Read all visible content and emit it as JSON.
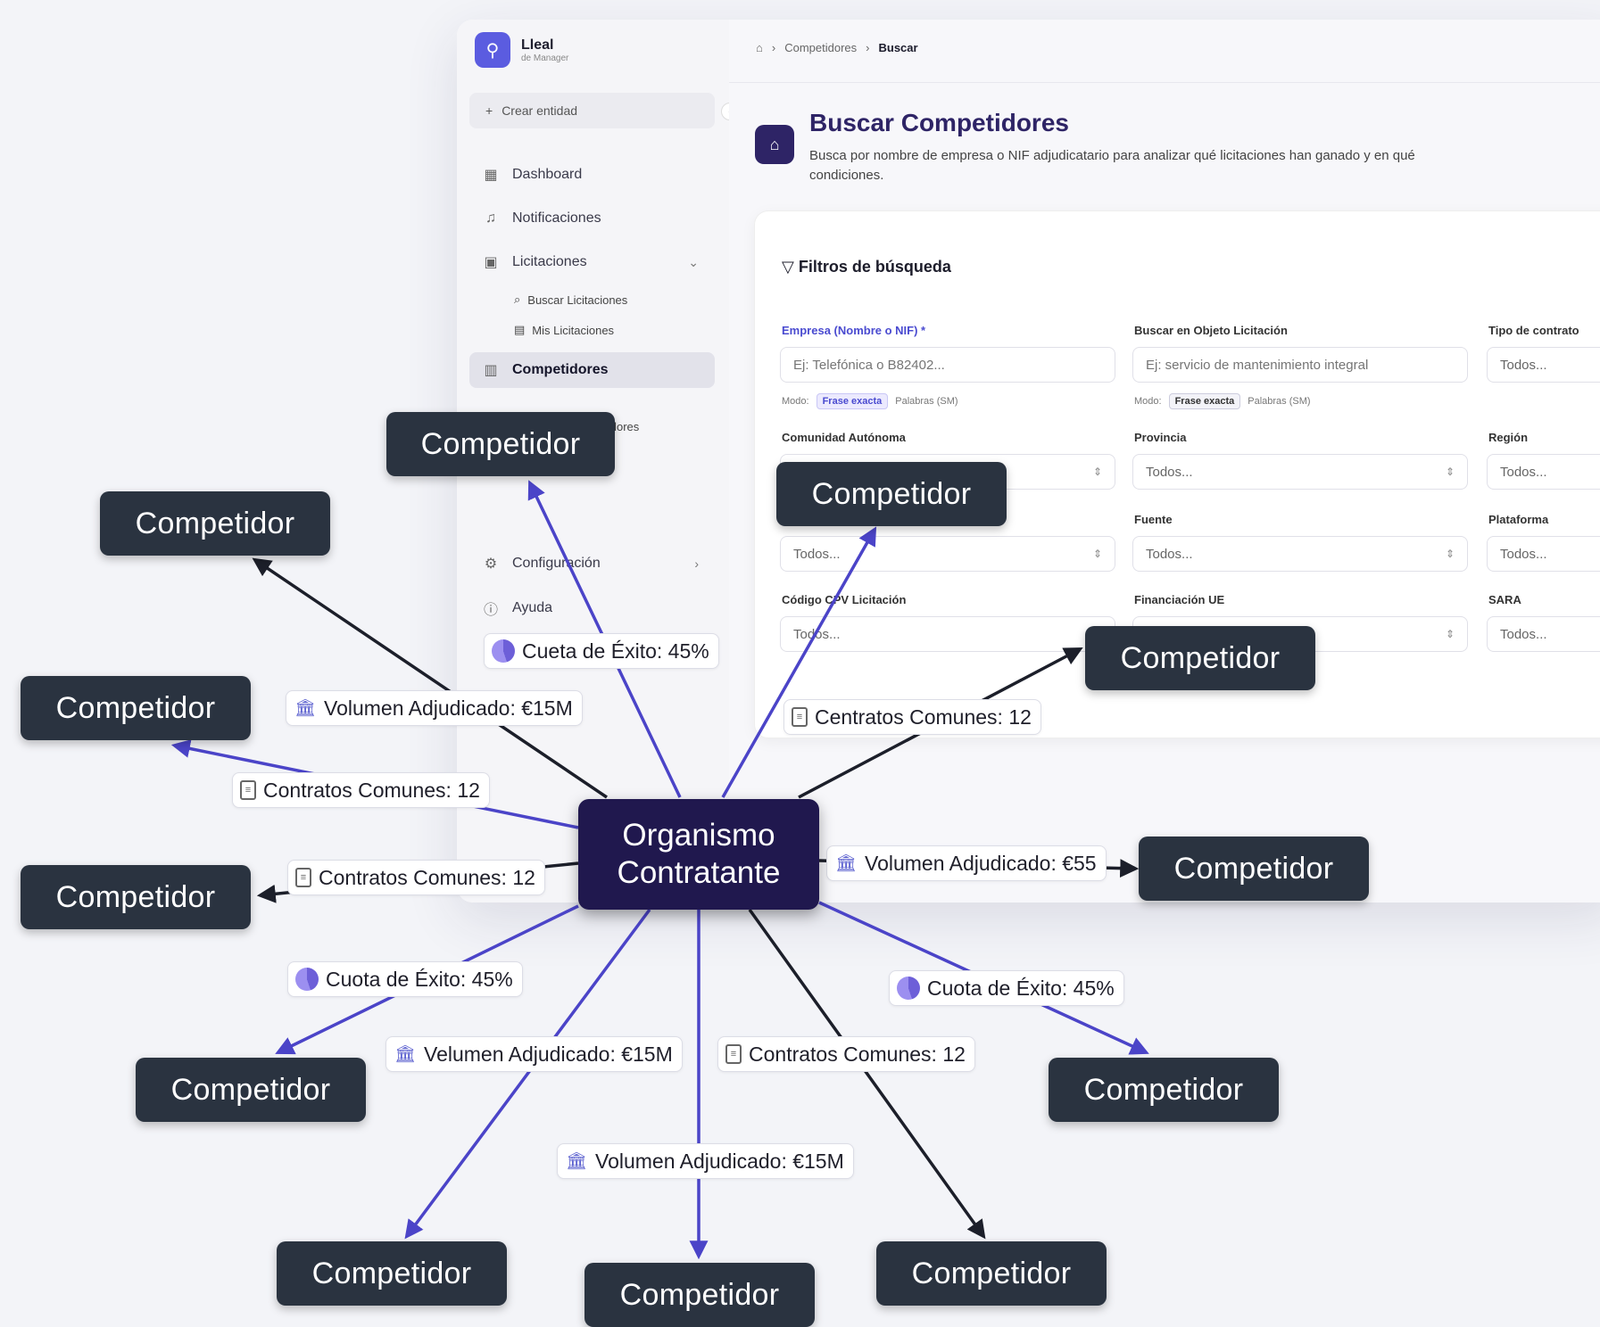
{
  "app": {
    "brand_name": "Lleal",
    "brand_sub": "de Manager",
    "create_entity": "Crear entidad",
    "nav": {
      "dashboard": "Dashboard",
      "notifications": "Notificaciones",
      "licitaciones": "Licitaciones",
      "buscar_licitaciones": "Buscar Licitaciones",
      "mis_licitaciones": "Mis Licitaciones",
      "competidores": "Competidores",
      "buscar_competidores": "Buscar Competidores",
      "configuracion": "Configuración",
      "ayuda": "Ayuda"
    },
    "breadcrumb": {
      "level1": "Competidores",
      "level2": "Buscar"
    },
    "page_title": "Buscar Competidores",
    "page_desc": "Busca por nombre de empresa o NIF adjudicatario para analizar qué licitaciones han ganado y en qué condiciones.",
    "filters": {
      "title": "Filtros de búsqueda",
      "empresa_label": "Empresa (Nombre o NIF) *",
      "empresa_placeholder": "Ej: Telefónica o B82402...",
      "objeto_label": "Buscar en Objeto Licitación",
      "objeto_placeholder": "Ej: servicio de mantenimiento integral",
      "tipo_label": "Tipo de contrato",
      "modo_label": "Modo:",
      "modo_exacta": "Frase exacta",
      "modo_palabras": "Palabras (SM)",
      "comunidad_label": "Comunidad Autónoma",
      "provincia_label": "Provincia",
      "region_label": "Región",
      "fuente_label": "Fuente",
      "plataforma_label": "Plataforma",
      "cpv_label": "Código CPV Licitación",
      "financiacion_label": "Financiación UE",
      "sara_label": "SARA",
      "todos": "Todos..."
    }
  },
  "diagram": {
    "center": {
      "line1": "Organismo",
      "line2": "Contratante"
    },
    "competitor_label": "Competidor",
    "edge_labels": [
      "Cueta de Éxito: 45%",
      "Volumen Adjudicado: €15M",
      "Contratos Comunes: 12",
      "Contratos Comunes: 12",
      "Cuota de Éxito: 45%",
      "Velumen Adjudicado: €15M",
      "Volumen Adjudicado: €15M",
      "Contratos Comunes: 12",
      "Cuota de Éxito: 45%",
      "Volumen Adjudicado: €55",
      "Centratos Comunes: 12"
    ],
    "colors": {
      "edge_purple": "#4b44c8",
      "edge_dark": "#1c1f2a",
      "node_bg": "#2a3340",
      "center_bg": "#20184e"
    }
  }
}
